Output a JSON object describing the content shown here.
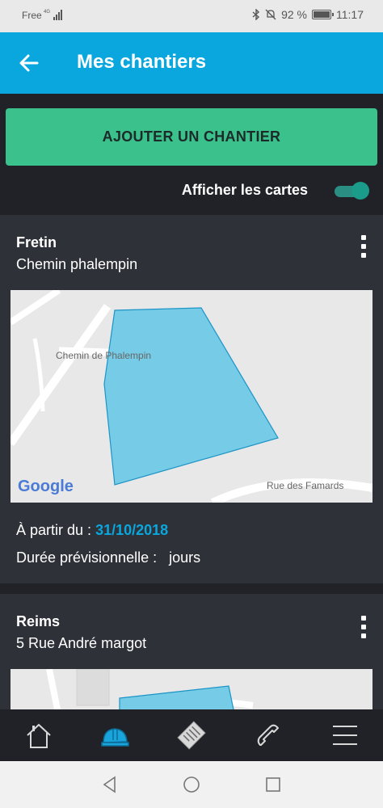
{
  "status_bar": {
    "carrier": "Free",
    "network": "4G",
    "battery_percent": "92 %",
    "time": "11:17"
  },
  "header": {
    "title": "Mes chantiers",
    "back_icon": "arrow-left-icon"
  },
  "add_button_label": "AJOUTER UN CHANTIER",
  "show_maps": {
    "label": "Afficher les cartes",
    "enabled": true
  },
  "sites": [
    {
      "name": "Fretin",
      "address": "Chemin phalempin",
      "map": {
        "street_label_1": "Chemin de Phalempin",
        "street_label_2": "Rue des Famards",
        "provider_logo": "Google"
      },
      "start_label": "À partir du :",
      "start_date": "31/10/2018",
      "duration_label": "Durée prévisionnelle :",
      "duration_unit": "jours"
    },
    {
      "name": "Reims",
      "address": "5 Rue André margot"
    }
  ],
  "bottom_nav": [
    {
      "icon": "home-icon",
      "active": false
    },
    {
      "icon": "hard-hat-icon",
      "active": true
    },
    {
      "icon": "document-icon",
      "active": false
    },
    {
      "icon": "phone-icon",
      "active": false
    },
    {
      "icon": "menu-icon",
      "active": false
    }
  ],
  "colors": {
    "header": "#09a7dd",
    "accent_green": "#3bc18b",
    "date_blue": "#09a7dd",
    "polygon_fill": "#76cbe6"
  }
}
